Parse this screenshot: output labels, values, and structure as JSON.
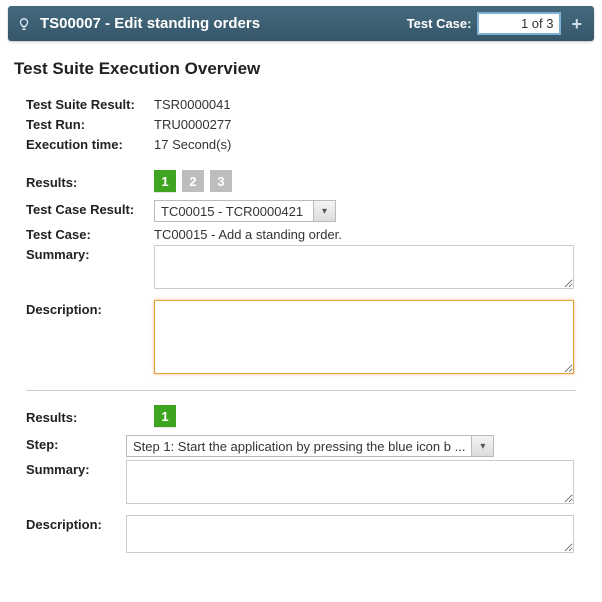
{
  "header": {
    "title": "TS00007 - Edit standing orders",
    "test_case_label": "Test Case:",
    "test_case_value": "1 of 3"
  },
  "page_title": "Test Suite Execution Overview",
  "overview": {
    "test_suite_result_label": "Test Suite Result:",
    "test_suite_result_value": "TSR0000041",
    "test_run_label": "Test Run:",
    "test_run_value": "TRU0000277",
    "execution_time_label": "Execution time:",
    "execution_time_value": "17 Second(s)"
  },
  "section1": {
    "results_label": "Results:",
    "pager": [
      "1",
      "2",
      "3"
    ],
    "test_case_result_label": "Test Case Result:",
    "test_case_result_value": "TC00015 - TCR0000421",
    "test_case_label": "Test Case:",
    "test_case_value": "TC00015 - Add a standing order.",
    "summary_label": "Summary:",
    "summary_value": "",
    "description_label": "Description:",
    "description_value": ""
  },
  "section2": {
    "results_label": "Results:",
    "pager": [
      "1"
    ],
    "step_label": "Step:",
    "step_value": "Step 1: Start the application by pressing the blue icon b ...",
    "summary_label": "Summary:",
    "summary_value": "",
    "description_label": "Description:",
    "description_value": ""
  }
}
